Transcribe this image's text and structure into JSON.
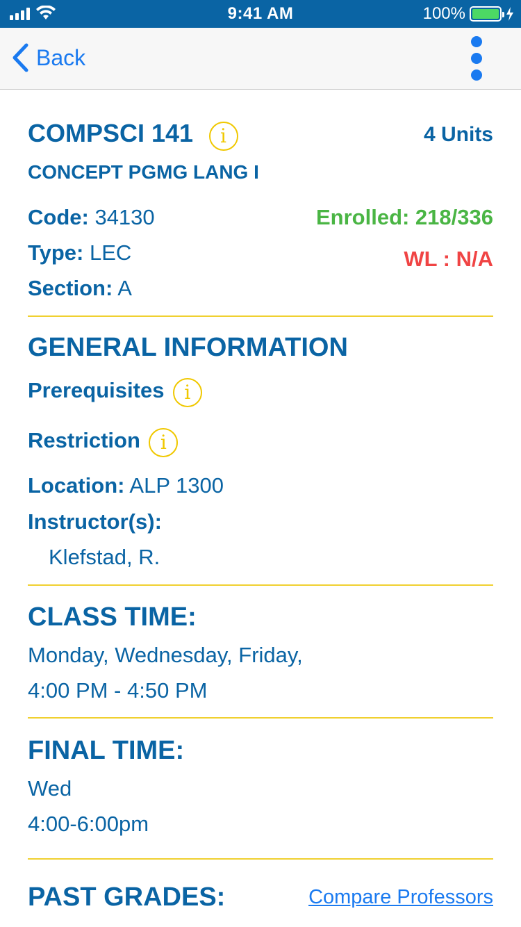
{
  "status_bar": {
    "time": "9:41 AM",
    "battery_percent": "100%",
    "battery_level": 1.0,
    "wifi_icon": "wifi-icon",
    "signal_icon": "signal-icon",
    "charging_icon": "bolt-icon"
  },
  "nav": {
    "back_label": "Back",
    "more_icon": "more-vertical-icon"
  },
  "course": {
    "title": "COMPSCI 141",
    "units": "4 Units",
    "subtitle": "CONCEPT PGMG LANG I",
    "code_label": "Code:",
    "code_value": "34130",
    "type_label": "Type:",
    "type_value": "LEC",
    "section_label": "Section:",
    "section_value": "A",
    "enrolled": "Enrolled: 218/336",
    "waitlist": "WL : N/A"
  },
  "general": {
    "heading": "GENERAL INFORMATION",
    "prerequisites_label": "Prerequisites",
    "restriction_label": "Restriction",
    "location_label": "Location:",
    "location_value": "ALP 1300",
    "instructors_label": "Instructor(s):",
    "instructor_name": "Klefstad, R."
  },
  "class_time": {
    "heading": "CLASS TIME:",
    "days": "Monday, Wednesday, Friday,",
    "hours": "4:00 PM - 4:50 PM"
  },
  "final_time": {
    "heading": "FINAL TIME:",
    "day": "Wed",
    "hours": "4:00-6:00pm"
  },
  "past_grades": {
    "heading": "PAST GRADES:",
    "compare_link": "Compare Professors"
  },
  "info_glyph": "i",
  "colors": {
    "primary": "#0a64a4",
    "accent_blue": "#1a7af0",
    "divider_yellow": "#f0d030",
    "info_yellow": "#f0c800",
    "enrolled_green": "#4ab544",
    "waitlist_red": "#f04444"
  }
}
